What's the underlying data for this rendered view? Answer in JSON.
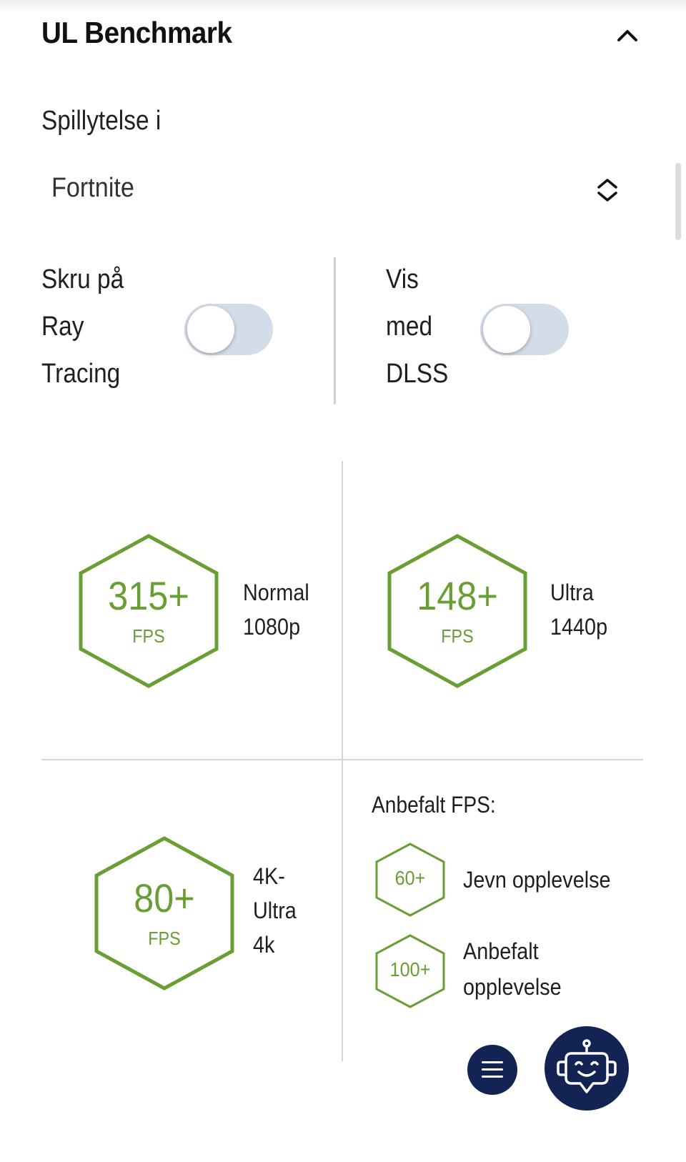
{
  "header": {
    "title": "UL Benchmark"
  },
  "section": {
    "label": "Spillytelse i"
  },
  "game_select": {
    "value": "Fortnite"
  },
  "toggles": {
    "ray_tracing": {
      "label_lines": [
        "Skru på",
        "Ray",
        "Tracing"
      ],
      "on": false
    },
    "dlss": {
      "label_lines": [
        "Vis",
        "med",
        "DLSS"
      ],
      "on": false
    }
  },
  "results": [
    {
      "value": "315+",
      "unit": "FPS",
      "label_lines": [
        "Normal",
        "1080p"
      ]
    },
    {
      "value": "148+",
      "unit": "FPS",
      "label_lines": [
        "Ultra",
        "1440p"
      ]
    },
    {
      "value": "80+",
      "unit": "FPS",
      "label_lines": [
        "4K-",
        "Ultra",
        "4k"
      ]
    }
  ],
  "recommended": {
    "title": "Anbefalt FPS:",
    "items": [
      {
        "value": "60+",
        "desc_lines": [
          "Jevn opplevelse"
        ]
      },
      {
        "value": "100+",
        "desc_lines": [
          "Anbefalt",
          "opplevelse"
        ]
      }
    ]
  },
  "colors": {
    "accent_green": "#6a9e35",
    "navy": "#132454",
    "toggle_off": "#d3dde9"
  },
  "icons": {
    "collapse": "chevron-up-icon",
    "select": "up-down-chevron-icon",
    "menu": "hamburger-menu-icon",
    "assistant": "robot-chat-icon"
  }
}
